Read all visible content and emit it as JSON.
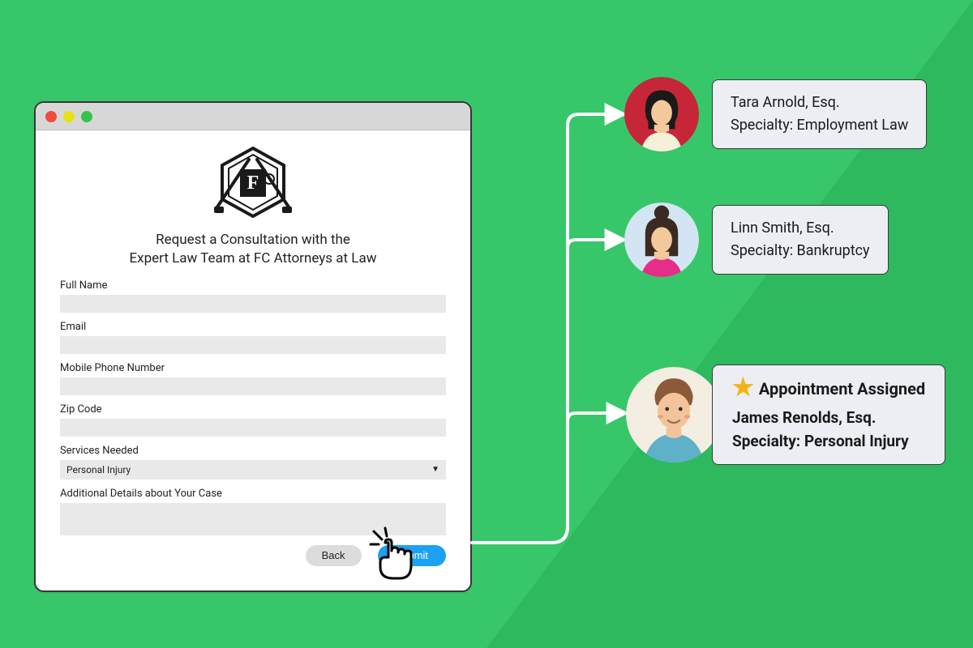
{
  "form": {
    "title_line1": "Request a Consultation with the",
    "title_line2": "Expert Law Team at FC Attorneys at Law",
    "fields": {
      "fullname_label": "Full Name",
      "email_label": "Email",
      "mobile_label": "Mobile Phone Number",
      "zip_label": "Zip Code",
      "services_label": "Services Needed",
      "services_selected": "Personal Injury",
      "details_label": "Additional Details about Your Case"
    },
    "buttons": {
      "back": "Back",
      "submit": "Submit"
    }
  },
  "attorneys": [
    {
      "name": "Tara Arnold, Esq.",
      "specialty_label": "Specialty: Employment Law"
    },
    {
      "name": "Linn Smith, Esq.",
      "specialty_label": "Specialty: Bankruptcy"
    },
    {
      "name": "James Renolds, Esq.",
      "specialty_label": "Specialty: Personal Injury",
      "assigned_header": "Appointment Assigned"
    }
  ]
}
